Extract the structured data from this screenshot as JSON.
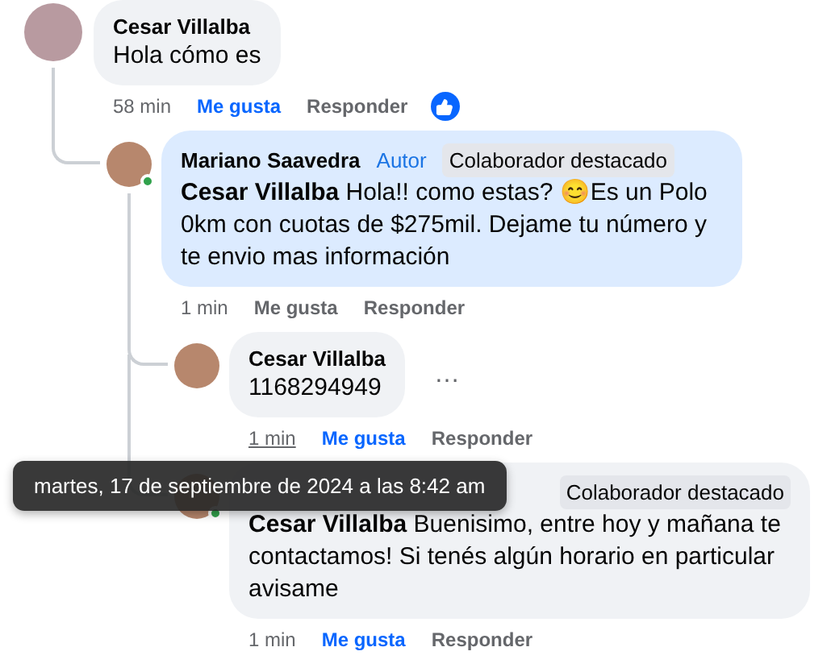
{
  "comments": [
    {
      "author": "Cesar Villalba",
      "text": "Hola cómo es",
      "time": "58 min",
      "time_hovered": false,
      "like": "Me gusta",
      "liked": true,
      "reply": "Responder",
      "reacted": true,
      "children": [
        {
          "author": "Mariano Saavedra",
          "online": true,
          "highlighted": true,
          "badges": [
            {
              "kind": "author",
              "label": "Autor"
            },
            {
              "kind": "contributor",
              "label": "Colaborador destacado"
            }
          ],
          "text": "**Cesar Villalba** Hola!! como estas? 😊Es un Polo 0km con cuotas de $275mil. Dejame tu número y te envio mas información",
          "time": "1 min",
          "time_hovered": false,
          "like": "Me gusta",
          "liked": false,
          "reply": "Responder",
          "children": [
            {
              "author": "Cesar Villalba",
              "text": "1168294949",
              "menu": "…",
              "time": "1 min",
              "time_hovered": true,
              "like": "Me gusta",
              "liked": true,
              "reply": "Responder"
            },
            {
              "online": true,
              "badges": [
                {
                  "kind": "contributor",
                  "label": "Colaborador destacado"
                }
              ],
              "text": "**Cesar Villalba** Buenisimo, entre hoy y mañana te contactamos! Si tenés algún horario en particular avisame",
              "time": "1 min",
              "time_hovered": false,
              "like": "Me gusta",
              "liked": true,
              "reply": "Responder"
            }
          ]
        }
      ]
    }
  ],
  "tooltip": "martes, 17 de septiembre de 2024 a las 8:42 am"
}
